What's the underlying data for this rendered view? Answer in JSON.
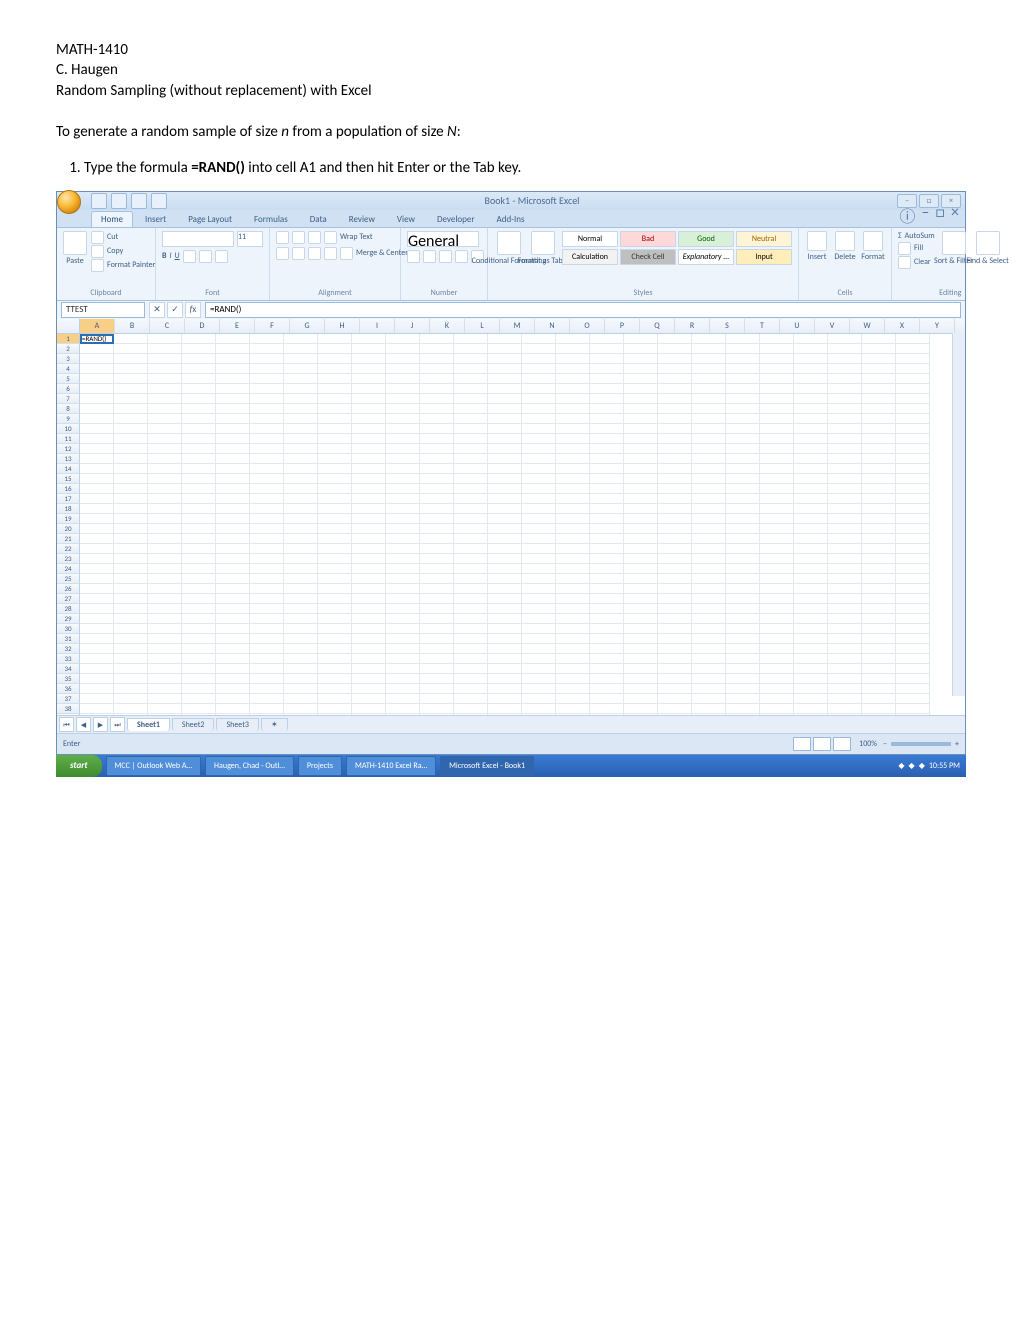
{
  "doc": {
    "course": "MATH-1410",
    "author": "C. Haugen",
    "title": "Random Sampling (without replacement) with Excel",
    "intro_pre": "To generate a random sample of size ",
    "intro_var1": "n",
    "intro_mid": " from a population of size ",
    "intro_var2": "N",
    "intro_post": ":",
    "step1_pre": "Type the formula ",
    "step1_formula": "=RAND()",
    "step1_post": " into cell A1 and then hit Enter or the Tab key."
  },
  "excel": {
    "title": "Book1 - Microsoft Excel",
    "tabs": [
      "Home",
      "Insert",
      "Page Layout",
      "Formulas",
      "Data",
      "Review",
      "View",
      "Developer",
      "Add-Ins"
    ],
    "active_tab": "Home",
    "clipboard": {
      "paste": "Paste",
      "cut": "Cut",
      "copy": "Copy",
      "fp": "Format Painter",
      "label": "Clipboard"
    },
    "font": {
      "label": "Font",
      "size": "11",
      "bold": "B",
      "italic": "I",
      "underline": "U"
    },
    "alignment": {
      "label": "Alignment",
      "wrap": "Wrap Text",
      "merge": "Merge & Center"
    },
    "number": {
      "label": "Number",
      "general": "General"
    },
    "styles": {
      "label": "Styles",
      "cond": "Conditional Formatting",
      "fat": "Format as Table",
      "normal": "Normal",
      "bad": "Bad",
      "good": "Good",
      "neutral": "Neutral",
      "calc": "Calculation",
      "check": "Check Cell",
      "expl": "Explanatory ...",
      "input": "Input"
    },
    "cells": {
      "label": "Cells",
      "insert": "Insert",
      "delete": "Delete",
      "format": "Format"
    },
    "editing": {
      "label": "Editing",
      "autosum": "AutoSum",
      "fill": "Fill",
      "clear": "Clear",
      "sort": "Sort & Filter",
      "find": "Find & Select"
    },
    "namebox": "TTEST",
    "formula": "=RAND()",
    "cellA1": "=RAND()",
    "columns": [
      "A",
      "B",
      "C",
      "D",
      "E",
      "F",
      "G",
      "H",
      "I",
      "J",
      "K",
      "L",
      "M",
      "N",
      "O",
      "P",
      "Q",
      "R",
      "S",
      "T",
      "U",
      "V",
      "W",
      "X",
      "Y"
    ],
    "rows": 39,
    "sheets": [
      "Sheet1",
      "Sheet2",
      "Sheet3"
    ],
    "status": "Enter",
    "zoom": "100%"
  },
  "taskbar": {
    "start": "start",
    "items": [
      "MCC | Outlook Web A…",
      "Haugen, Chad - Outl…",
      "Projects",
      "MATH-1410 Excel Ra…",
      "Microsoft Excel - Book1"
    ],
    "time": "10:55 PM"
  }
}
